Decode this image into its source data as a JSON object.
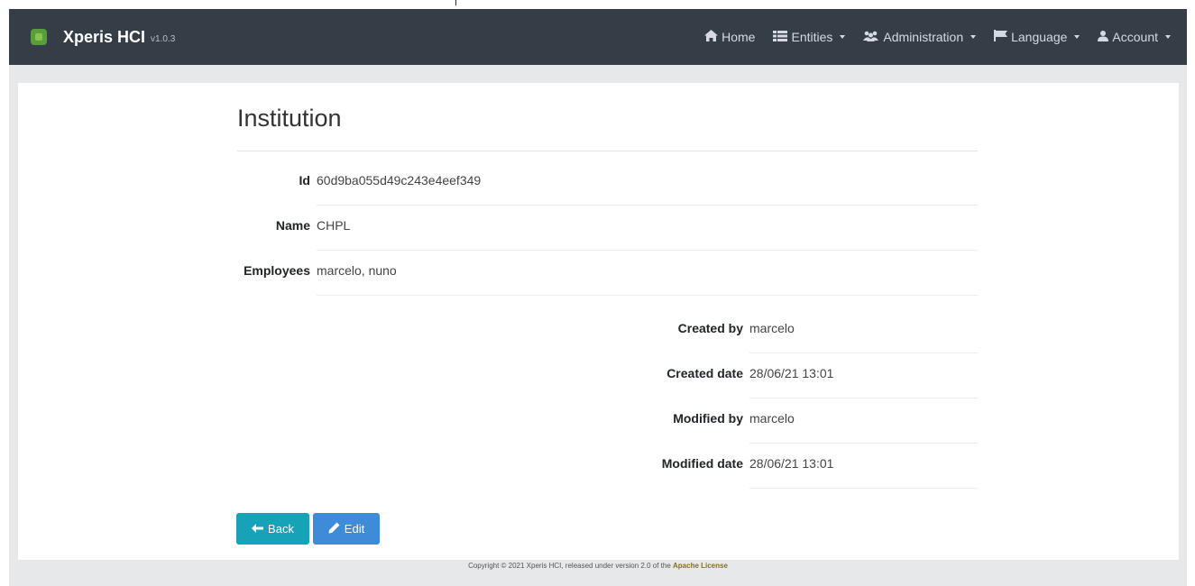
{
  "brand": {
    "title": "Xperis HCI",
    "version": "v1.0.3"
  },
  "nav": {
    "home": "Home",
    "entities": "Entities",
    "administration": "Administration",
    "language": "Language",
    "account": "Account"
  },
  "icons": {
    "home": "home-icon",
    "entities": "list-icon",
    "administration": "users-icon",
    "language": "flag-icon",
    "account": "user-icon",
    "back": "arrow-left-icon",
    "edit": "pencil-icon"
  },
  "page": {
    "title": "Institution"
  },
  "fields": [
    {
      "label": "Id",
      "value": "60d9ba055d49c243e4eef349"
    },
    {
      "label": "Name",
      "value": "CHPL"
    },
    {
      "label": "Employees",
      "value": "marcelo, nuno"
    }
  ],
  "audit": [
    {
      "label": "Created by",
      "value": "marcelo"
    },
    {
      "label": "Created date",
      "value": "28/06/21 13:01"
    },
    {
      "label": "Modified by",
      "value": "marcelo"
    },
    {
      "label": "Modified date",
      "value": "28/06/21 13:01"
    }
  ],
  "buttons": {
    "back": "Back",
    "edit": "Edit"
  },
  "footer": {
    "text": "Copyright © 2021 Xperis HCI, released under version 2.0 of the",
    "license": "Apache License"
  },
  "colors": {
    "navbar": "#353d47",
    "back_button": "#17a2b8",
    "edit_button": "#3e8bd8",
    "license_link": "#8a6d1f"
  }
}
